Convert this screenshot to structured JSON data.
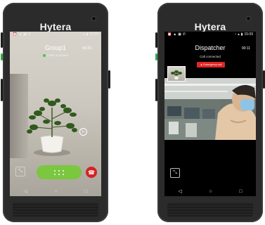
{
  "device1": {
    "brand": "Hytera",
    "status_bar": {
      "left_icons": [
        "alarm-icon",
        "notification-icon",
        "image-icon",
        "call-icon",
        "wifi-icon",
        "battery-icon"
      ],
      "time": "15:09"
    },
    "call": {
      "title": "Group1",
      "timer": "00:29",
      "status_text": "Have occupied"
    },
    "controls": {
      "ptt_label": "",
      "end_call_icon": "hang-up-icon",
      "expand_icon": "shrink-icon",
      "switch_camera_icon": "switch-camera-icon"
    },
    "nav": [
      "◁",
      "○",
      "□"
    ],
    "colors": {
      "ptt": "#7bc73f",
      "end_call": "#d32323",
      "status_dot": "#4cc34f"
    }
  },
  "device2": {
    "brand": "Hytera",
    "status_bar": {
      "time": "15:09"
    },
    "call": {
      "title": "Dispatcher",
      "timer": "00:11",
      "status_text": "Call connected",
      "emergency_label": "Emergency call"
    },
    "controls": {
      "expand_icon": "shrink-icon"
    },
    "nav": [
      "◁",
      "○",
      "□"
    ],
    "colors": {
      "emergency": "#e02525"
    }
  }
}
